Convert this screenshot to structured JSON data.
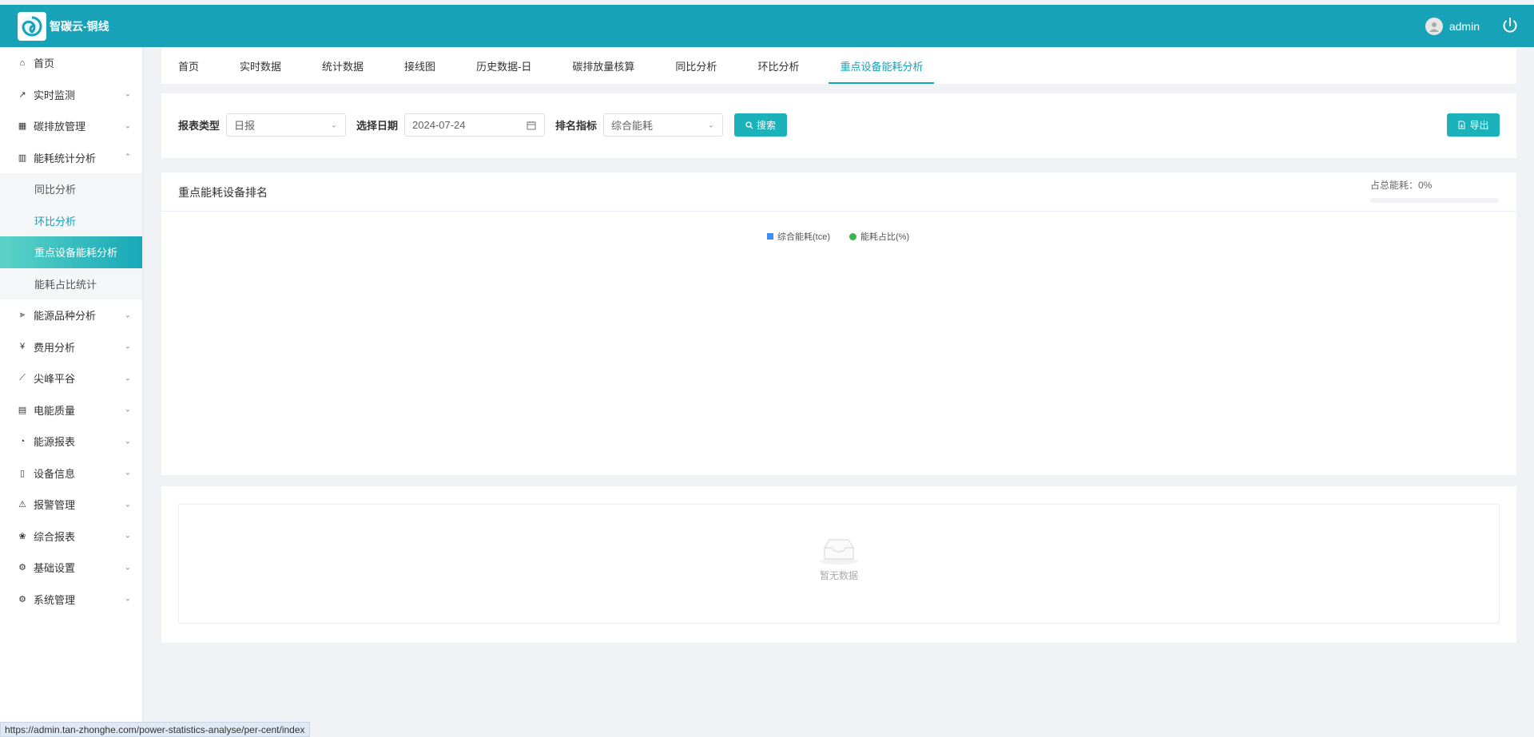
{
  "header": {
    "brand": "智碳云-铜线",
    "username": "admin"
  },
  "sidebar": {
    "items": [
      {
        "label": "首页",
        "icon": "home-icon",
        "expandable": false
      },
      {
        "label": "实时监测",
        "icon": "trend-icon",
        "expandable": true
      },
      {
        "label": "碳排放管理",
        "icon": "bar-chart-icon",
        "expandable": true
      },
      {
        "label": "能耗统计分析",
        "icon": "column-chart-icon",
        "expandable": true,
        "expanded": true,
        "children": [
          {
            "label": "同比分析",
            "state": "normal"
          },
          {
            "label": "环比分析",
            "state": "highlight"
          },
          {
            "label": "重点设备能耗分析",
            "state": "selected"
          },
          {
            "label": "能耗占比统计",
            "state": "normal"
          }
        ]
      },
      {
        "label": "能源品种分析",
        "icon": "energy-icon",
        "expandable": true
      },
      {
        "label": "费用分析",
        "icon": "yen-icon",
        "expandable": true
      },
      {
        "label": "尖峰平谷",
        "icon": "line-chart-icon",
        "expandable": true
      },
      {
        "label": "电能质量",
        "icon": "calendar-icon",
        "expandable": true
      },
      {
        "label": "能源报表",
        "icon": "pie-icon",
        "expandable": true
      },
      {
        "label": "设备信息",
        "icon": "document-icon",
        "expandable": true
      },
      {
        "label": "报警管理",
        "icon": "alarm-icon",
        "expandable": true
      },
      {
        "label": "综合报表",
        "icon": "gift-icon",
        "expandable": true
      },
      {
        "label": "基础设置",
        "icon": "gear-icon",
        "expandable": true
      },
      {
        "label": "系统管理",
        "icon": "gear-icon",
        "expandable": true
      }
    ]
  },
  "tabs": [
    "首页",
    "实时数据",
    "统计数据",
    "接线图",
    "历史数据-日",
    "碳排放量核算",
    "同比分析",
    "环比分析",
    "重点设备能耗分析"
  ],
  "active_tab_index": 8,
  "filters": {
    "report_type_label": "报表类型",
    "report_type_value": "日报",
    "date_label": "选择日期",
    "date_value": "2024-07-24",
    "rank_label": "排名指标",
    "rank_value": "综合能耗",
    "search_label": "搜索",
    "export_label": "导出"
  },
  "chart": {
    "title": "重点能耗设备排名",
    "total_share_text": "占总能耗：0%",
    "total_share_percent": 0,
    "legend": [
      {
        "name": "综合能耗(tce)",
        "color": "#3d8ff5",
        "shape": "square"
      },
      {
        "name": "能耗占比(%)",
        "color": "#3cb54a",
        "shape": "circle"
      }
    ]
  },
  "table": {
    "empty_text": "暂无数据"
  },
  "status_url": "https://admin.tan-zhonghe.com/power-statistics-analyse/per-cent/index",
  "colors": {
    "primary": "#17a2b8",
    "sidebar_selected": "#17a8b8",
    "legend_blue": "#3d8ff5",
    "legend_green": "#3cb54a"
  }
}
